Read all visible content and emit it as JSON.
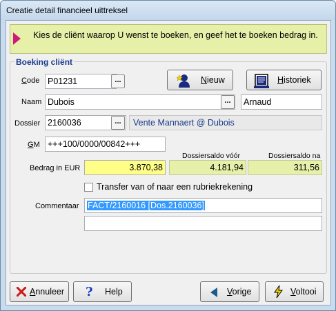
{
  "window": {
    "title": "Creatie detail financieel uittreksel"
  },
  "banner": {
    "text": "Kies de cliënt waarop U wenst te boeken, en geef het te boeken bedrag in."
  },
  "group": {
    "label": "Boeking cliënt"
  },
  "code": {
    "label_first": "C",
    "label_rest": "ode",
    "value": "P01231",
    "dots": "..."
  },
  "naam": {
    "label": "Naam",
    "value": "Dubois",
    "dots": "...",
    "firstname": "Arnaud"
  },
  "dossier": {
    "label": "Dossier",
    "value": "2160036",
    "dots": "...",
    "description": "Vente Mannaert @ Dubois"
  },
  "gm": {
    "label_first": "G",
    "label_rest": "M",
    "value": "+++100/0000/00842+++"
  },
  "bedrag": {
    "label": "Bedrag in EUR",
    "value": "3.870,38"
  },
  "saldo_voor": {
    "caption": "Dossiersaldo vóór",
    "value": "4.181,94"
  },
  "saldo_na": {
    "caption": "Dossiersaldo na",
    "value": "311,56"
  },
  "transfer": {
    "label": "Transfer van of naar een rubriekrekening",
    "checked": false
  },
  "commentaar": {
    "label": "Commentaar",
    "line1": "FACT/2160016 [Dos.2160036]",
    "line2": ""
  },
  "buttons": {
    "nieuw": {
      "first": "N",
      "rest": "ieuw"
    },
    "historiek": {
      "first": "H",
      "rest": "istoriek"
    },
    "annuleer": {
      "first": "A",
      "rest": "nnuleer"
    },
    "help": {
      "label": "Help"
    },
    "vorige": {
      "first": "V",
      "rest": "orige"
    },
    "voltooi": {
      "first": "V",
      "rest": "oltooi"
    }
  },
  "colors": {
    "accent_arrow": "#d01a7a",
    "banner_bg": "#e6f0a8",
    "amount_bg": "#ffff88",
    "selection": "#3399ff"
  }
}
